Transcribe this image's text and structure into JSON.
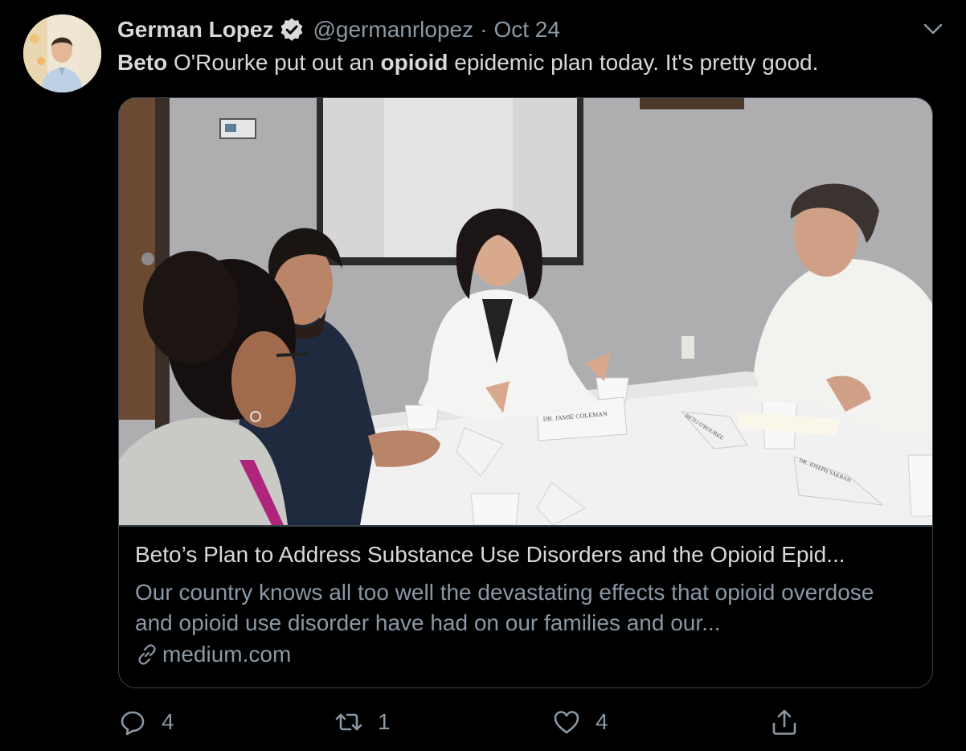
{
  "tweet": {
    "author_name": "German Lopez",
    "handle": "@germanrlopez",
    "separator": "·",
    "date": "Oct 24",
    "text_parts": [
      "Beto",
      " O'Rourke put out an ",
      "opioid",
      " epidemic plan today. It's pretty good."
    ]
  },
  "card": {
    "title": "Beto’s Plan to Address Substance Use Disorders and the Opioid Epid...",
    "description": "Our country knows all too well the devastating effects that opioid overdose and opioid use disorder have had on our families and our...",
    "domain": "medium.com",
    "image_placards": [
      "DR. JAMIE COLEMAN",
      "BETO O'ROURKE",
      "DR. JOSEPH SAKRAN"
    ]
  },
  "actions": {
    "replies": "4",
    "retweets": "1",
    "likes": "4"
  },
  "colors": {
    "background": "#000000",
    "primary_text": "#d9d9d9",
    "secondary_text": "#8b98a5",
    "border": "#38444d",
    "verified_badge": "#d9d9d9"
  },
  "icons": {
    "verified": "verified-badge-icon",
    "caret": "chevron-down-icon",
    "link": "link-icon",
    "reply": "reply-icon",
    "retweet": "retweet-icon",
    "like": "heart-icon",
    "share": "share-icon"
  }
}
